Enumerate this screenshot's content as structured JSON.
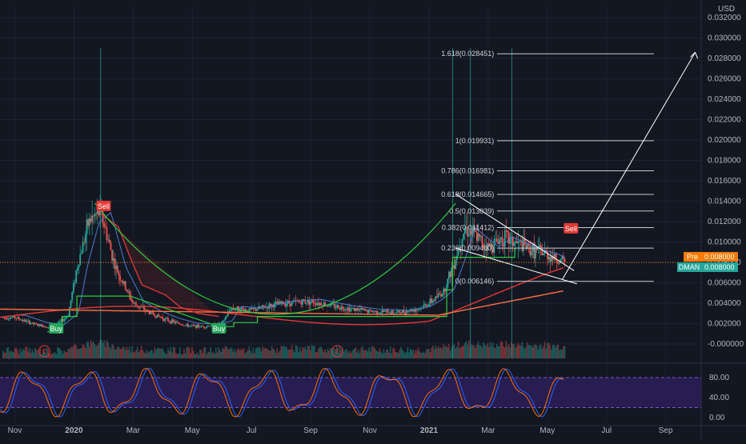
{
  "currency_label": "USD",
  "colors": {
    "background": "#131722",
    "grid": "#1f2330",
    "candle_up": "#26a69a",
    "candle_down": "#ef5350",
    "fib_line": "#c9cbd1",
    "buy": "#26a65b",
    "sell": "#e53935",
    "stoch_band": "#2d1f5e",
    "stoch_k": "#2962ff",
    "stoch_d": "#ff6d00",
    "pre_tag": "#f57c00",
    "last_tag": "#26a69a",
    "curve": "#2ecc40",
    "ema_fast": "#e53935",
    "ema_slow": "#ff7043",
    "ma_blue": "#4a7bd1"
  },
  "chart_data": [
    {
      "type": "candlestick",
      "symbol": "DMAN",
      "ylim": [
        -0.001,
        0.0335
      ],
      "y_ticks": [
        "0.032000",
        "0.030000",
        "0.028000",
        "0.026000",
        "0.024000",
        "0.022000",
        "0.020000",
        "0.018000",
        "0.016000",
        "0.014000",
        "0.012000",
        "0.010000",
        "0.008000",
        "0.006000",
        "0.004000",
        "0.002000",
        "-0.000000"
      ],
      "y_tick_values": [
        0.032,
        0.03,
        0.028,
        0.026,
        0.024,
        0.022,
        0.02,
        0.018,
        0.016,
        0.014,
        0.012,
        0.01,
        0.008,
        0.006,
        0.004,
        0.002,
        0.0
      ],
      "x_ticks": [
        "Nov",
        "2020",
        "Mar",
        "May",
        "Jul",
        "Sep",
        "Nov",
        "2021",
        "Mar",
        "May",
        "Jul",
        "Sep"
      ],
      "x_tick_months": [
        0,
        2,
        4,
        6,
        8,
        10,
        12,
        14,
        16,
        18,
        20,
        22
      ],
      "x_month_range": [
        -0.5,
        23.2
      ],
      "fibonacci_levels": [
        {
          "label": "1.618(0.028451)",
          "value": 0.028451
        },
        {
          "label": "1(0.019931)",
          "value": 0.019931
        },
        {
          "label": "0.786(0.016981)",
          "value": 0.016981
        },
        {
          "label": "0.618(0.014665)",
          "value": 0.014665
        },
        {
          "label": "0.5(0.013039)",
          "value": 0.013039
        },
        {
          "label": "0.382(0.011412)",
          "value": 0.011412
        },
        {
          "label": "0.236(0.009400)",
          "value": 0.0094
        },
        {
          "label": "0(0.006146)",
          "value": 0.006146
        }
      ],
      "price_tags": [
        {
          "label": "Pre",
          "value_text": "0.008000",
          "value": 0.008
        },
        {
          "label": "DMAN",
          "value_text": "0.008000",
          "value": 0.008
        }
      ],
      "signals": [
        {
          "label": "Buy",
          "month": 1.4,
          "value": 0.0015
        },
        {
          "label": "Sell",
          "month": 3.0,
          "value": 0.0135
        },
        {
          "label": "Buy",
          "month": 6.9,
          "value": 0.0015
        },
        {
          "label": "Sell",
          "month": 18.8,
          "value": 0.0113
        }
      ],
      "events": [
        {
          "label": "E",
          "month": 1.0
        },
        {
          "label": "E",
          "month": 10.9
        }
      ],
      "price_anchors": [
        [
          0,
          0.0026
        ],
        [
          0.7,
          0.0019
        ],
        [
          1.3,
          0.0016
        ],
        [
          1.8,
          0.0028
        ],
        [
          2.1,
          0.0075
        ],
        [
          2.5,
          0.012
        ],
        [
          2.9,
          0.013
        ],
        [
          3.4,
          0.0075
        ],
        [
          4,
          0.004
        ],
        [
          4.6,
          0.003
        ],
        [
          5.2,
          0.0023
        ],
        [
          5.8,
          0.0018
        ],
        [
          6.4,
          0.0017
        ],
        [
          7,
          0.002
        ],
        [
          7.3,
          0.0035
        ],
        [
          8,
          0.0033
        ],
        [
          9,
          0.004
        ],
        [
          10,
          0.0042
        ],
        [
          11,
          0.0036
        ],
        [
          12,
          0.0032
        ],
        [
          13,
          0.0031
        ],
        [
          13.7,
          0.0035
        ],
        [
          14.1,
          0.0042
        ],
        [
          14.5,
          0.0052
        ],
        [
          14.9,
          0.0085
        ],
        [
          15.2,
          0.0115
        ],
        [
          15.6,
          0.0105
        ],
        [
          16,
          0.0095
        ],
        [
          16.5,
          0.0105
        ],
        [
          17,
          0.0098
        ],
        [
          17.5,
          0.0092
        ],
        [
          18,
          0.0088
        ],
        [
          18.4,
          0.0082
        ],
        [
          18.6,
          0.008
        ]
      ],
      "volume_spikes": [
        2.9,
        14.8,
        15.4,
        16.8
      ]
    },
    {
      "type": "line",
      "indicator": "stochastic",
      "ylim": [
        -5,
        100
      ],
      "y_ticks": [
        "80.00",
        "40.00",
        "0.00"
      ],
      "y_tick_values": [
        80,
        40,
        0
      ],
      "band": [
        20,
        80
      ]
    }
  ]
}
